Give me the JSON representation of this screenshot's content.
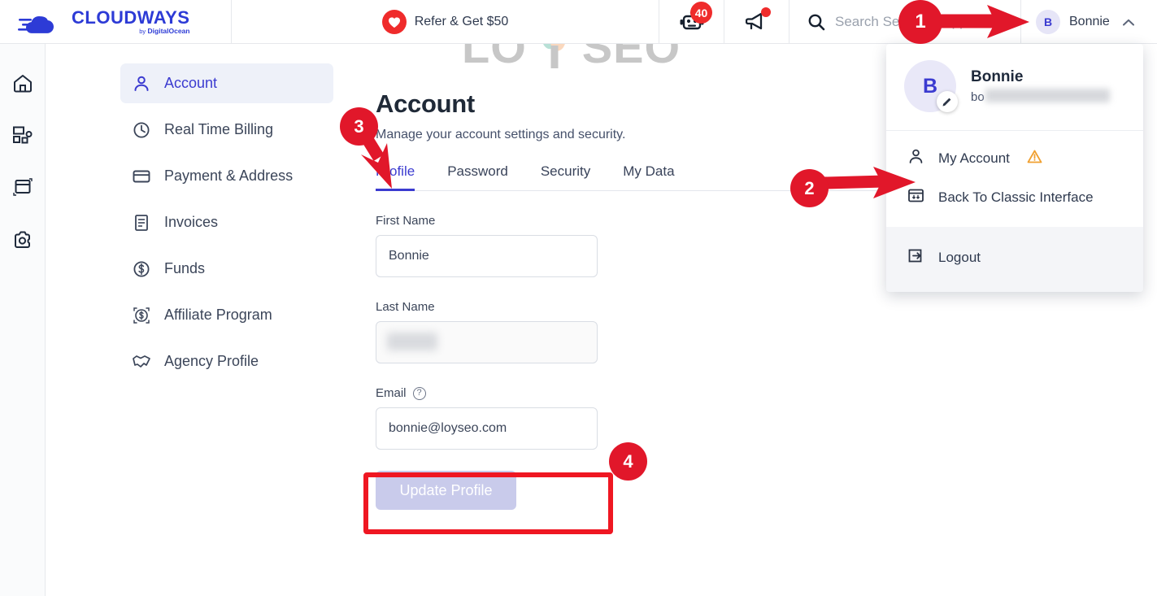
{
  "brand": {
    "logo_word": "CLOUDWAYS",
    "logo_by": "by",
    "logo_sub": "DigitalOcean"
  },
  "topbar": {
    "refer_label": "Refer & Get $50",
    "heart_icon": "heart-icon",
    "bot_icon": "robot-icon",
    "bot_badge": "40",
    "megaphone_icon": "megaphone-icon",
    "search_icon": "search-icon",
    "search_placeholder": "Search Server or App",
    "search_value": "",
    "avatar_initial": "B",
    "profile_name": "Bonnie",
    "chevron_icon": "chevron-up-icon"
  },
  "rail": {
    "items": [
      {
        "name": "home-icon",
        "label": "Home"
      },
      {
        "name": "servers-icon",
        "label": "Servers"
      },
      {
        "name": "applications-icon",
        "label": "Applications"
      },
      {
        "name": "settings-icon",
        "label": "Settings"
      }
    ]
  },
  "sidebar": {
    "items": [
      {
        "label": "Account",
        "icon": "user-icon",
        "active": true
      },
      {
        "label": "Real Time Billing",
        "icon": "clock-icon",
        "active": false
      },
      {
        "label": "Payment & Address",
        "icon": "credit-card-icon",
        "active": false
      },
      {
        "label": "Invoices",
        "icon": "invoice-icon",
        "active": false
      },
      {
        "label": "Funds",
        "icon": "dollar-circle-icon",
        "active": false
      },
      {
        "label": "Affiliate Program",
        "icon": "affiliate-icon",
        "active": false
      },
      {
        "label": "Agency Profile",
        "icon": "handshake-icon",
        "active": false
      }
    ]
  },
  "main": {
    "title": "Account",
    "subtitle": "Manage your account settings and security.",
    "tabs": [
      {
        "label": "Profile",
        "active": true
      },
      {
        "label": "Password",
        "active": false
      },
      {
        "label": "Security",
        "active": false
      },
      {
        "label": "My Data",
        "active": false
      }
    ],
    "form": {
      "first_name_label": "First Name",
      "first_name_value": "Bonnie",
      "last_name_label": "Last Name",
      "last_name_value": "",
      "email_label": "Email",
      "email_help_icon": "help-icon",
      "email_value": "bonnie@loyseo.com",
      "update_button": "Update Profile"
    }
  },
  "dropdown": {
    "avatar_initial": "B",
    "name": "Bonnie",
    "email_prefix": "bo",
    "edit_icon": "pencil-icon",
    "items": [
      {
        "label": "My Account",
        "icon": "user-icon",
        "warning_icon": "warning-triangle-icon"
      },
      {
        "label": "Back To Classic Interface",
        "icon": "classic-interface-icon",
        "warning_icon": ""
      }
    ],
    "logout": {
      "label": "Logout",
      "icon": "logout-icon"
    }
  },
  "watermark": {
    "left_text": "LO",
    "right_text": "SEO"
  },
  "annotations": [
    {
      "number": "1",
      "target": "profile-menu"
    },
    {
      "number": "2",
      "target": "my-account-item"
    },
    {
      "number": "3",
      "target": "profile-tab"
    },
    {
      "number": "4",
      "target": "email-field"
    }
  ],
  "colors": {
    "brand_blue": "#2d3bd6",
    "accent_indigo": "#3b3bd0",
    "annotation_red": "#e1172a",
    "badge_red": "#ef2b2b",
    "warning_orange": "#f0a030"
  }
}
